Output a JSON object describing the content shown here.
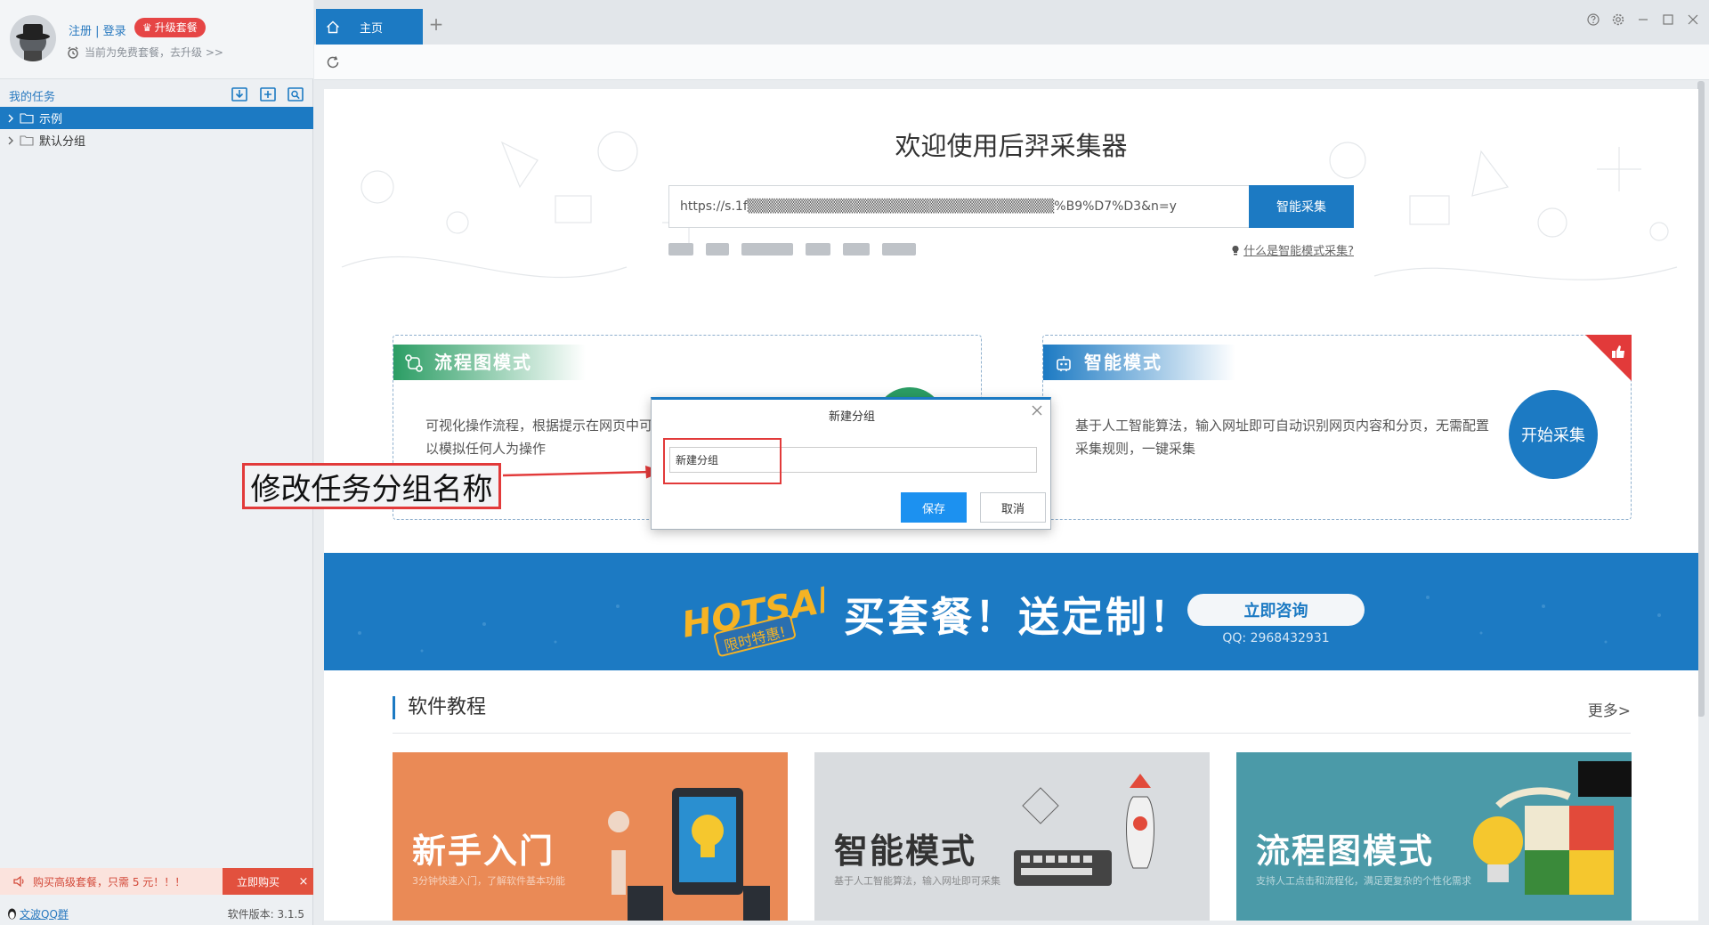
{
  "user": {
    "login_link": "注册 | 登录",
    "upgrade_label": "升级套餐",
    "package_info": "当前为免费套餐，去升级 >>"
  },
  "tasks": {
    "header": "我的任务",
    "tree": [
      {
        "label": "示例",
        "selected": true
      },
      {
        "label": "默认分组",
        "selected": false
      }
    ]
  },
  "promo": {
    "text": "购买高级套餐，只需 5 元！！！",
    "buy_label": "立即购买"
  },
  "status": {
    "qq_link": "文波QQ群",
    "version": "软件版本: 3.1.5"
  },
  "tabs": {
    "home_label": "主页",
    "new_tab": "+"
  },
  "home": {
    "welcome_title": "欢迎使用后羿采集器",
    "url_value": "https://s.1f▒▒▒▒▒▒▒▒▒▒▒▒▒▒▒▒▒▒▒▒▒▒▒▒▒▒▒▒▒▒▒▒%B9%D7%D3&n=y",
    "smart_button": "智能采集",
    "smart_hint": "什么是智能模式采集?"
  },
  "modes": {
    "flow": {
      "title": "流程图模式",
      "desc": "可视化操作流程，根据提示在网页中可以模拟任何人为操作"
    },
    "smart": {
      "title": "智能模式",
      "desc": "基于人工智能算法，输入网址即可自动识别网页内容和分页，无需配置采集规则，一键采集",
      "start_button": "开始采集"
    }
  },
  "banner": {
    "hotsale_word": "HOTSALE",
    "hotsale_tag": "限时特惠!",
    "text": "买套餐！送定制！",
    "consult_button": "立即咨询",
    "qq": "QQ: 2968432931"
  },
  "tutorials": {
    "title": "软件教程",
    "more": "更多>",
    "cards": [
      {
        "title": "新手入门",
        "subtitle": "3分钟快速入门，了解软件基本功能"
      },
      {
        "title": "智能模式",
        "subtitle": "基于人工智能算法，输入网址即可采集"
      },
      {
        "title": "流程图模式",
        "subtitle": "支持人工点击和流程化，满足更复杂的个性化需求"
      }
    ]
  },
  "dialog": {
    "title": "新建分组",
    "input_value": "新建分组",
    "save_label": "保存",
    "cancel_label": "取消"
  },
  "annotation": {
    "text": "修改任务分组名称"
  },
  "colors": {
    "accent": "#1c7ac3",
    "flow_green": "#2b9d64",
    "annotation_red": "#e23a3a",
    "promo_red": "#e2513e"
  }
}
